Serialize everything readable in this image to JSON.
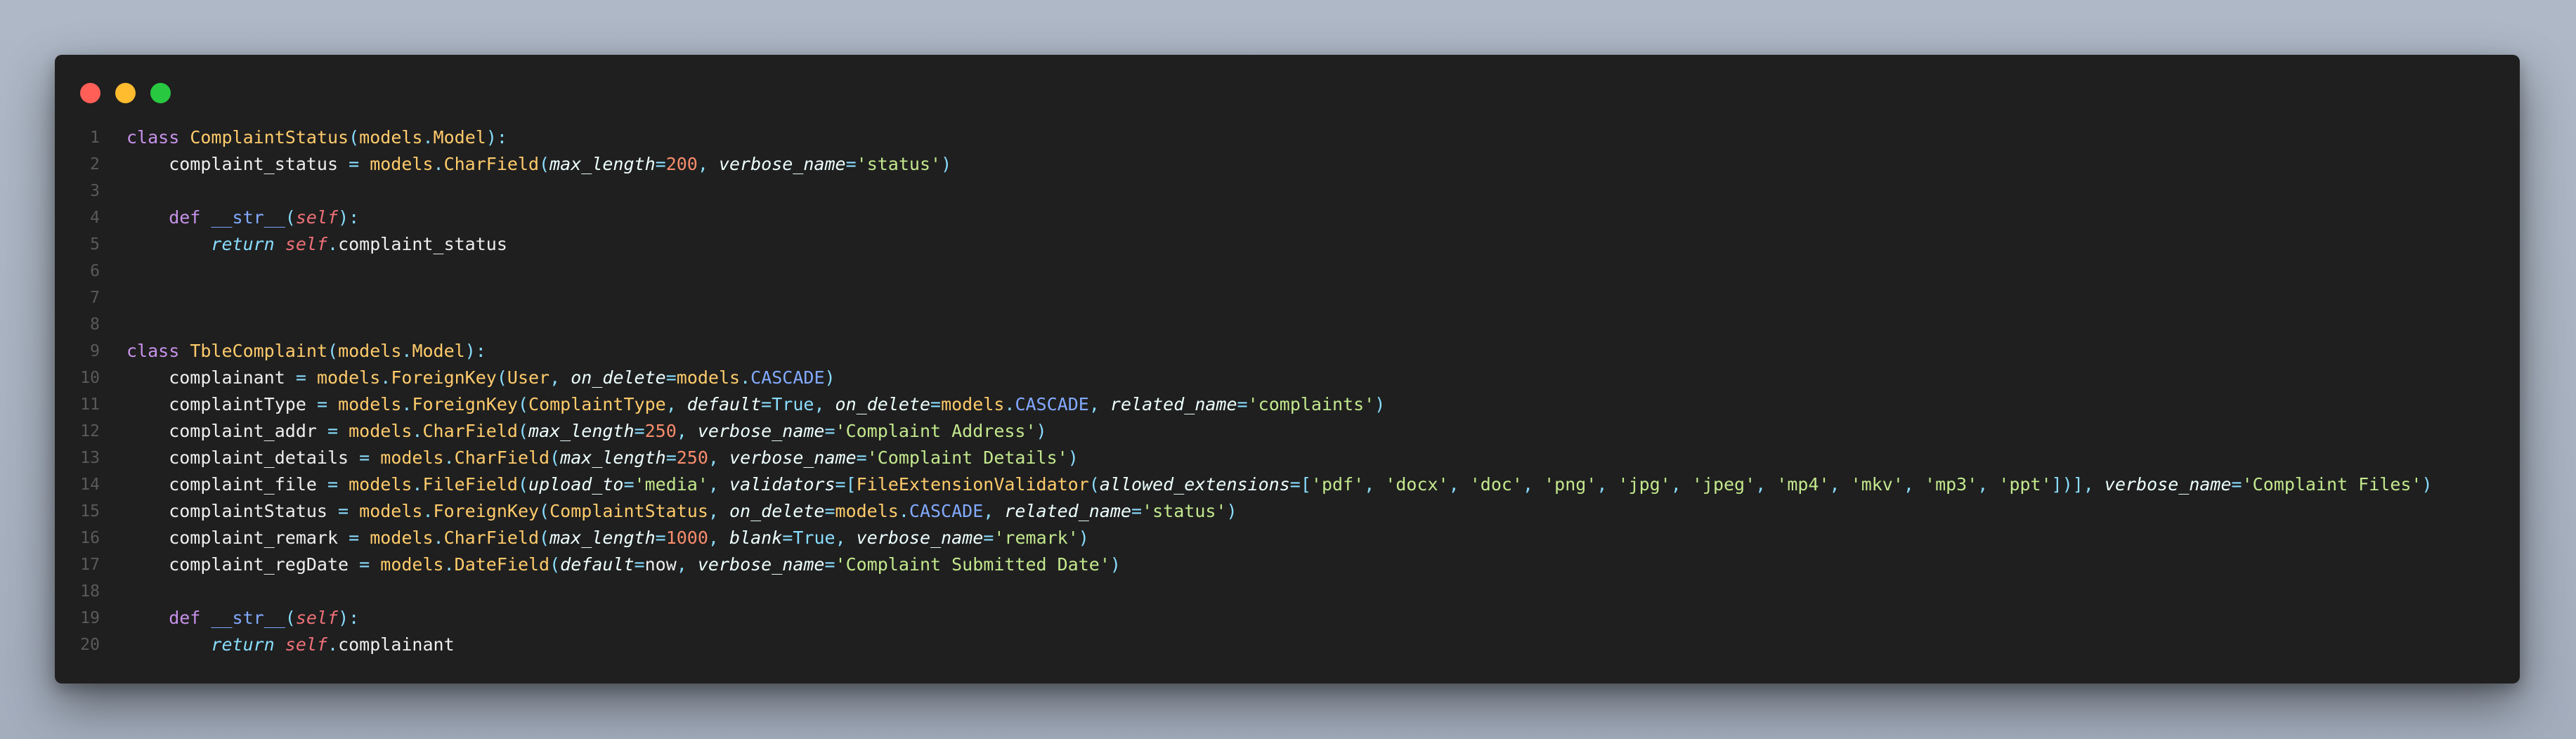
{
  "window": {
    "controls": [
      {
        "name": "close",
        "color": "#ff5f57"
      },
      {
        "name": "minimize",
        "color": "#febc2e"
      },
      {
        "name": "maximize",
        "color": "#28c840"
      }
    ]
  },
  "theme": {
    "background": "#1f1f1f",
    "keyword": "#c792ea",
    "class_name": "#ffcb6b",
    "function": "#82aaff",
    "number": "#f78c6c",
    "string": "#c3e88d",
    "self": "#f07178",
    "operator": "#89ddff",
    "line_number": "#5a5a5a"
  },
  "code": {
    "language": "python",
    "lines": [
      {
        "n": "1",
        "tokens": [
          [
            "kw",
            "class"
          ],
          [
            "",
            " "
          ],
          [
            "cls",
            "ComplaintStatus"
          ],
          [
            "pn",
            "("
          ],
          [
            "cls",
            "models"
          ],
          [
            "pn",
            "."
          ],
          [
            "cls",
            "Model"
          ],
          [
            "pn",
            "):"
          ]
        ]
      },
      {
        "n": "2",
        "tokens": [
          [
            "",
            "    complaint_status "
          ],
          [
            "op",
            "="
          ],
          [
            "",
            " "
          ],
          [
            "cls",
            "models"
          ],
          [
            "pn",
            "."
          ],
          [
            "cls",
            "CharField"
          ],
          [
            "pn",
            "("
          ],
          [
            "par",
            "max_length"
          ],
          [
            "op",
            "="
          ],
          [
            "num",
            "200"
          ],
          [
            "pn",
            ", "
          ],
          [
            "par",
            "verbose_name"
          ],
          [
            "op",
            "="
          ],
          [
            "str",
            "'status'"
          ],
          [
            "pn",
            ")"
          ]
        ]
      },
      {
        "n": "3",
        "tokens": []
      },
      {
        "n": "4",
        "tokens": [
          [
            "kw",
            "    def"
          ],
          [
            "",
            " "
          ],
          [
            "fn",
            "__str__"
          ],
          [
            "pn",
            "("
          ],
          [
            "slf",
            "self"
          ],
          [
            "pn",
            "):"
          ]
        ]
      },
      {
        "n": "5",
        "tokens": [
          [
            "ret",
            "        return"
          ],
          [
            "",
            " "
          ],
          [
            "slf",
            "self"
          ],
          [
            "pn",
            "."
          ],
          [
            "",
            "complaint_status"
          ]
        ]
      },
      {
        "n": "6",
        "tokens": []
      },
      {
        "n": "7",
        "tokens": []
      },
      {
        "n": "8",
        "tokens": []
      },
      {
        "n": "9",
        "tokens": [
          [
            "kw",
            "class"
          ],
          [
            "",
            " "
          ],
          [
            "cls",
            "TbleComplaint"
          ],
          [
            "pn",
            "("
          ],
          [
            "cls",
            "models"
          ],
          [
            "pn",
            "."
          ],
          [
            "cls",
            "Model"
          ],
          [
            "pn",
            "):"
          ]
        ]
      },
      {
        "n": "10",
        "tokens": [
          [
            "",
            "    complainant "
          ],
          [
            "op",
            "="
          ],
          [
            "",
            " "
          ],
          [
            "cls",
            "models"
          ],
          [
            "pn",
            "."
          ],
          [
            "cls",
            "ForeignKey"
          ],
          [
            "pn",
            "("
          ],
          [
            "cls",
            "User"
          ],
          [
            "pn",
            ", "
          ],
          [
            "par",
            "on_delete"
          ],
          [
            "op",
            "="
          ],
          [
            "cls",
            "models"
          ],
          [
            "pn",
            "."
          ],
          [
            "fn",
            "CASCADE"
          ],
          [
            "pn",
            ")"
          ]
        ]
      },
      {
        "n": "11",
        "tokens": [
          [
            "",
            "    complaintType "
          ],
          [
            "op",
            "="
          ],
          [
            "",
            " "
          ],
          [
            "cls",
            "models"
          ],
          [
            "pn",
            "."
          ],
          [
            "cls",
            "ForeignKey"
          ],
          [
            "pn",
            "("
          ],
          [
            "cls",
            "ComplaintType"
          ],
          [
            "pn",
            ", "
          ],
          [
            "par",
            "default"
          ],
          [
            "op",
            "="
          ],
          [
            "pn",
            "True"
          ],
          [
            "pn",
            ", "
          ],
          [
            "par",
            "on_delete"
          ],
          [
            "op",
            "="
          ],
          [
            "cls",
            "models"
          ],
          [
            "pn",
            "."
          ],
          [
            "fn",
            "CASCADE"
          ],
          [
            "pn",
            ", "
          ],
          [
            "par",
            "related_name"
          ],
          [
            "op",
            "="
          ],
          [
            "str",
            "'complaints'"
          ],
          [
            "pn",
            ")"
          ]
        ]
      },
      {
        "n": "12",
        "tokens": [
          [
            "",
            "    complaint_addr "
          ],
          [
            "op",
            "="
          ],
          [
            "",
            " "
          ],
          [
            "cls",
            "models"
          ],
          [
            "pn",
            "."
          ],
          [
            "cls",
            "CharField"
          ],
          [
            "pn",
            "("
          ],
          [
            "par",
            "max_length"
          ],
          [
            "op",
            "="
          ],
          [
            "num",
            "250"
          ],
          [
            "pn",
            ", "
          ],
          [
            "par",
            "verbose_name"
          ],
          [
            "op",
            "="
          ],
          [
            "str",
            "'Complaint Address'"
          ],
          [
            "pn",
            ")"
          ]
        ]
      },
      {
        "n": "13",
        "tokens": [
          [
            "",
            "    complaint_details "
          ],
          [
            "op",
            "="
          ],
          [
            "",
            " "
          ],
          [
            "cls",
            "models"
          ],
          [
            "pn",
            "."
          ],
          [
            "cls",
            "CharField"
          ],
          [
            "pn",
            "("
          ],
          [
            "par",
            "max_length"
          ],
          [
            "op",
            "="
          ],
          [
            "num",
            "250"
          ],
          [
            "pn",
            ", "
          ],
          [
            "par",
            "verbose_name"
          ],
          [
            "op",
            "="
          ],
          [
            "str",
            "'Complaint Details'"
          ],
          [
            "pn",
            ")"
          ]
        ]
      },
      {
        "n": "14",
        "tokens": [
          [
            "",
            "    complaint_file "
          ],
          [
            "op",
            "="
          ],
          [
            "",
            " "
          ],
          [
            "cls",
            "models"
          ],
          [
            "pn",
            "."
          ],
          [
            "cls",
            "FileField"
          ],
          [
            "pn",
            "("
          ],
          [
            "par",
            "upload_to"
          ],
          [
            "op",
            "="
          ],
          [
            "str",
            "'media'"
          ],
          [
            "pn",
            ", "
          ],
          [
            "par",
            "validators"
          ],
          [
            "op",
            "="
          ],
          [
            "pn",
            "["
          ],
          [
            "cls",
            "FileExtensionValidator"
          ],
          [
            "pn",
            "("
          ],
          [
            "par",
            "allowed_extensions"
          ],
          [
            "op",
            "="
          ],
          [
            "pn",
            "["
          ],
          [
            "str",
            "'pdf'"
          ],
          [
            "pn",
            ", "
          ],
          [
            "str",
            "'docx'"
          ],
          [
            "pn",
            ", "
          ],
          [
            "str",
            "'doc'"
          ],
          [
            "pn",
            ", "
          ],
          [
            "str",
            "'png'"
          ],
          [
            "pn",
            ", "
          ],
          [
            "str",
            "'jpg'"
          ],
          [
            "pn",
            ", "
          ],
          [
            "str",
            "'jpeg'"
          ],
          [
            "pn",
            ", "
          ],
          [
            "str",
            "'mp4'"
          ],
          [
            "pn",
            ", "
          ],
          [
            "str",
            "'mkv'"
          ],
          [
            "pn",
            ", "
          ],
          [
            "str",
            "'mp3'"
          ],
          [
            "pn",
            ", "
          ],
          [
            "str",
            "'ppt'"
          ],
          [
            "pn",
            "])], "
          ],
          [
            "par",
            "verbose_name"
          ],
          [
            "op",
            "="
          ],
          [
            "str",
            "'Complaint Files'"
          ],
          [
            "pn",
            ")"
          ]
        ]
      },
      {
        "n": "15",
        "tokens": [
          [
            "",
            "    complaintStatus "
          ],
          [
            "op",
            "="
          ],
          [
            "",
            " "
          ],
          [
            "cls",
            "models"
          ],
          [
            "pn",
            "."
          ],
          [
            "cls",
            "ForeignKey"
          ],
          [
            "pn",
            "("
          ],
          [
            "cls",
            "ComplaintStatus"
          ],
          [
            "pn",
            ", "
          ],
          [
            "par",
            "on_delete"
          ],
          [
            "op",
            "="
          ],
          [
            "cls",
            "models"
          ],
          [
            "pn",
            "."
          ],
          [
            "fn",
            "CASCADE"
          ],
          [
            "pn",
            ", "
          ],
          [
            "par",
            "related_name"
          ],
          [
            "op",
            "="
          ],
          [
            "str",
            "'status'"
          ],
          [
            "pn",
            ")"
          ]
        ]
      },
      {
        "n": "16",
        "tokens": [
          [
            "",
            "    complaint_remark "
          ],
          [
            "op",
            "="
          ],
          [
            "",
            " "
          ],
          [
            "cls",
            "models"
          ],
          [
            "pn",
            "."
          ],
          [
            "cls",
            "CharField"
          ],
          [
            "pn",
            "("
          ],
          [
            "par",
            "max_length"
          ],
          [
            "op",
            "="
          ],
          [
            "num",
            "1000"
          ],
          [
            "pn",
            ", "
          ],
          [
            "par",
            "blank"
          ],
          [
            "op",
            "="
          ],
          [
            "pn",
            "True"
          ],
          [
            "pn",
            ", "
          ],
          [
            "par",
            "verbose_name"
          ],
          [
            "op",
            "="
          ],
          [
            "str",
            "'remark'"
          ],
          [
            "pn",
            ")"
          ]
        ]
      },
      {
        "n": "17",
        "tokens": [
          [
            "",
            "    complaint_regDate "
          ],
          [
            "op",
            "="
          ],
          [
            "",
            " "
          ],
          [
            "cls",
            "models"
          ],
          [
            "pn",
            "."
          ],
          [
            "cls",
            "DateField"
          ],
          [
            "pn",
            "("
          ],
          [
            "par",
            "default"
          ],
          [
            "op",
            "="
          ],
          [
            "",
            "now"
          ],
          [
            "pn",
            ", "
          ],
          [
            "par",
            "verbose_name"
          ],
          [
            "op",
            "="
          ],
          [
            "str",
            "'Complaint Submitted Date'"
          ],
          [
            "pn",
            ")"
          ]
        ]
      },
      {
        "n": "18",
        "tokens": []
      },
      {
        "n": "19",
        "tokens": [
          [
            "kw",
            "    def"
          ],
          [
            "",
            " "
          ],
          [
            "fn",
            "__str__"
          ],
          [
            "pn",
            "("
          ],
          [
            "slf",
            "self"
          ],
          [
            "pn",
            "):"
          ]
        ]
      },
      {
        "n": "20",
        "tokens": [
          [
            "ret",
            "        return"
          ],
          [
            "",
            " "
          ],
          [
            "slf",
            "self"
          ],
          [
            "pn",
            "."
          ],
          [
            "",
            "complainant"
          ]
        ]
      }
    ]
  }
}
